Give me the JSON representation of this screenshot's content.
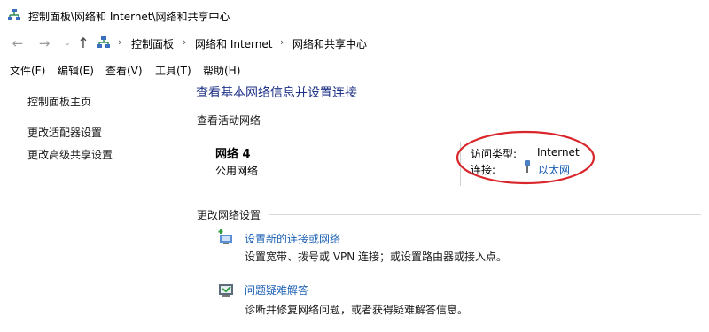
{
  "window": {
    "title": "控制面板\\网络和 Internet\\网络和共享中心"
  },
  "address_bar": {
    "crumbs": [
      "控制面板",
      "网络和 Internet",
      "网络和共享中心"
    ],
    "separator": "›"
  },
  "menu": [
    "文件(F)",
    "编辑(E)",
    "查看(V)",
    "工具(T)",
    "帮助(H)"
  ],
  "sidebar": {
    "items": [
      {
        "label": "控制面板主页"
      },
      {
        "label": "更改适配器设置"
      },
      {
        "label": "更改高级共享设置"
      }
    ]
  },
  "main": {
    "title": "查看基本网络信息并设置连接",
    "active_section": "查看活动网络",
    "network": {
      "name": "网络  4",
      "profile": "公用网络",
      "access_label": "访问类型:",
      "access_value": "Internet",
      "connection_label": "连接:",
      "connection_value": "以太网"
    },
    "change_section": "更改网络设置",
    "tasks": [
      {
        "link": "设置新的连接或网络",
        "desc": "设置宽带、拨号或 VPN 连接；或设置路由器或接入点。",
        "icon": "network-setup-icon"
      },
      {
        "link": "问题疑难解答",
        "desc": "诊断并修复网络问题，或者获得疑难解答信息。",
        "icon": "troubleshoot-icon"
      }
    ]
  },
  "colors": {
    "title_blue": "#1e3287",
    "link_blue": "#1a5fb4",
    "highlight_red": "#d9262b"
  }
}
